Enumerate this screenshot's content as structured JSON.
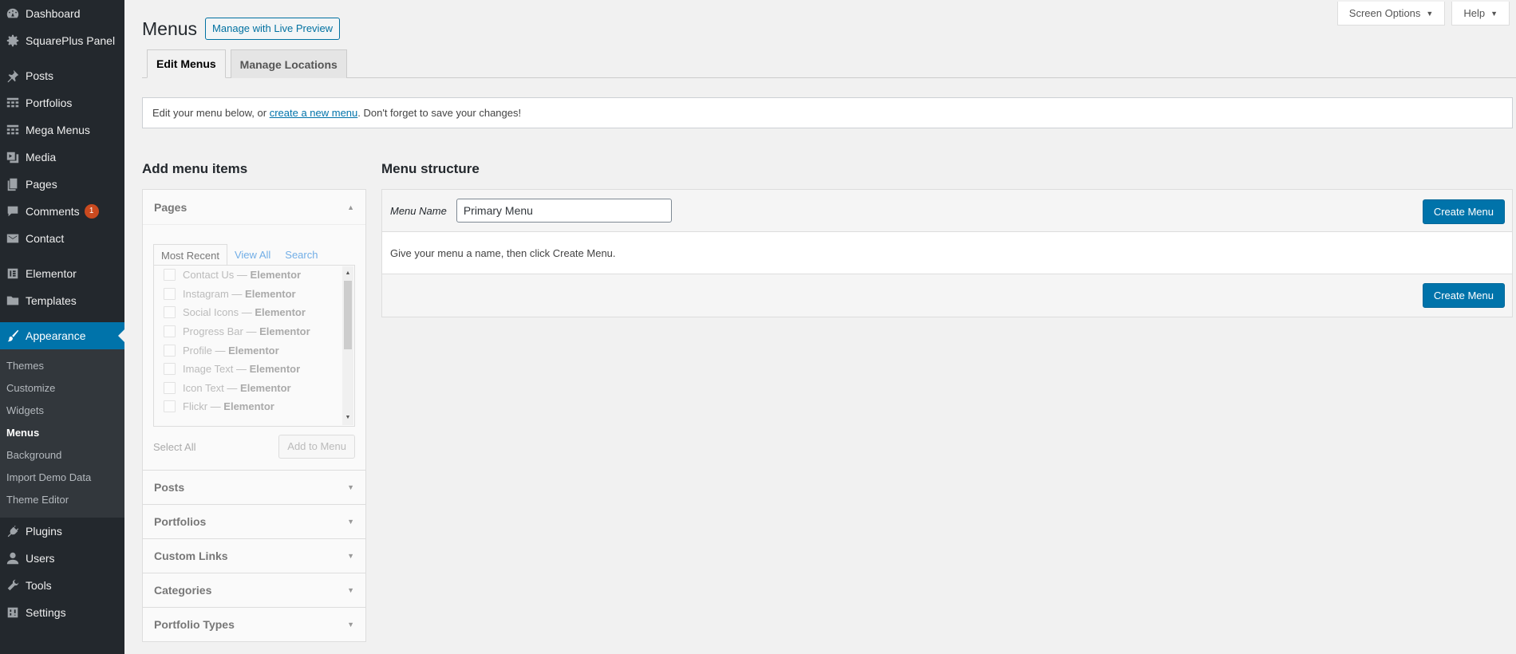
{
  "sidebar": {
    "items": [
      {
        "label": "Dashboard",
        "icon": "dashboard-icon"
      },
      {
        "label": "SquarePlus Panel",
        "icon": "gear-icon"
      },
      {
        "label": "Posts",
        "icon": "pin-icon"
      },
      {
        "label": "Portfolios",
        "icon": "grid-icon"
      },
      {
        "label": "Mega Menus",
        "icon": "grid-icon"
      },
      {
        "label": "Media",
        "icon": "media-icon"
      },
      {
        "label": "Pages",
        "icon": "pages-icon"
      },
      {
        "label": "Comments",
        "icon": "comment-icon",
        "badge": "1"
      },
      {
        "label": "Contact",
        "icon": "mail-icon"
      },
      {
        "label": "Elementor",
        "icon": "elementor-icon"
      },
      {
        "label": "Templates",
        "icon": "folder-icon"
      },
      {
        "label": "Appearance",
        "icon": "brush-icon"
      },
      {
        "label": "Plugins",
        "icon": "plug-icon"
      },
      {
        "label": "Users",
        "icon": "user-icon"
      },
      {
        "label": "Tools",
        "icon": "wrench-icon"
      },
      {
        "label": "Settings",
        "icon": "settings-icon"
      }
    ],
    "submenu": [
      "Themes",
      "Customize",
      "Widgets",
      "Menus",
      "Background",
      "Import Demo Data",
      "Theme Editor"
    ]
  },
  "screen_meta": {
    "screen_options": "Screen Options",
    "help": "Help"
  },
  "header": {
    "title": "Menus",
    "live_preview": "Manage with Live Preview"
  },
  "tabs": [
    "Edit Menus",
    "Manage Locations"
  ],
  "notice": {
    "before": "Edit your menu below, or ",
    "link": "create a new menu",
    "after": ". Don't forget to save your changes!"
  },
  "add_items": {
    "title": "Add menu items",
    "pages_label": "Pages",
    "inner_tabs": [
      "Most Recent",
      "View All",
      "Search"
    ],
    "pages": [
      {
        "name": "Contact Us",
        "suffix": "Elementor"
      },
      {
        "name": "Instagram",
        "suffix": "Elementor"
      },
      {
        "name": "Social Icons",
        "suffix": "Elementor"
      },
      {
        "name": "Progress Bar",
        "suffix": "Elementor"
      },
      {
        "name": "Profile",
        "suffix": "Elementor"
      },
      {
        "name": "Image Text",
        "suffix": "Elementor"
      },
      {
        "name": "Icon Text",
        "suffix": "Elementor"
      },
      {
        "name": "Flickr",
        "suffix": "Elementor"
      }
    ],
    "separator": " — ",
    "select_all": "Select All",
    "add_to_menu": "Add to Menu",
    "sections": [
      "Posts",
      "Portfolios",
      "Custom Links",
      "Categories",
      "Portfolio Types"
    ]
  },
  "structure": {
    "title": "Menu structure",
    "menu_name_label": "Menu Name",
    "menu_name_value": "Primary Menu",
    "create_button": "Create Menu",
    "hint": "Give your menu a name, then click Create Menu."
  }
}
